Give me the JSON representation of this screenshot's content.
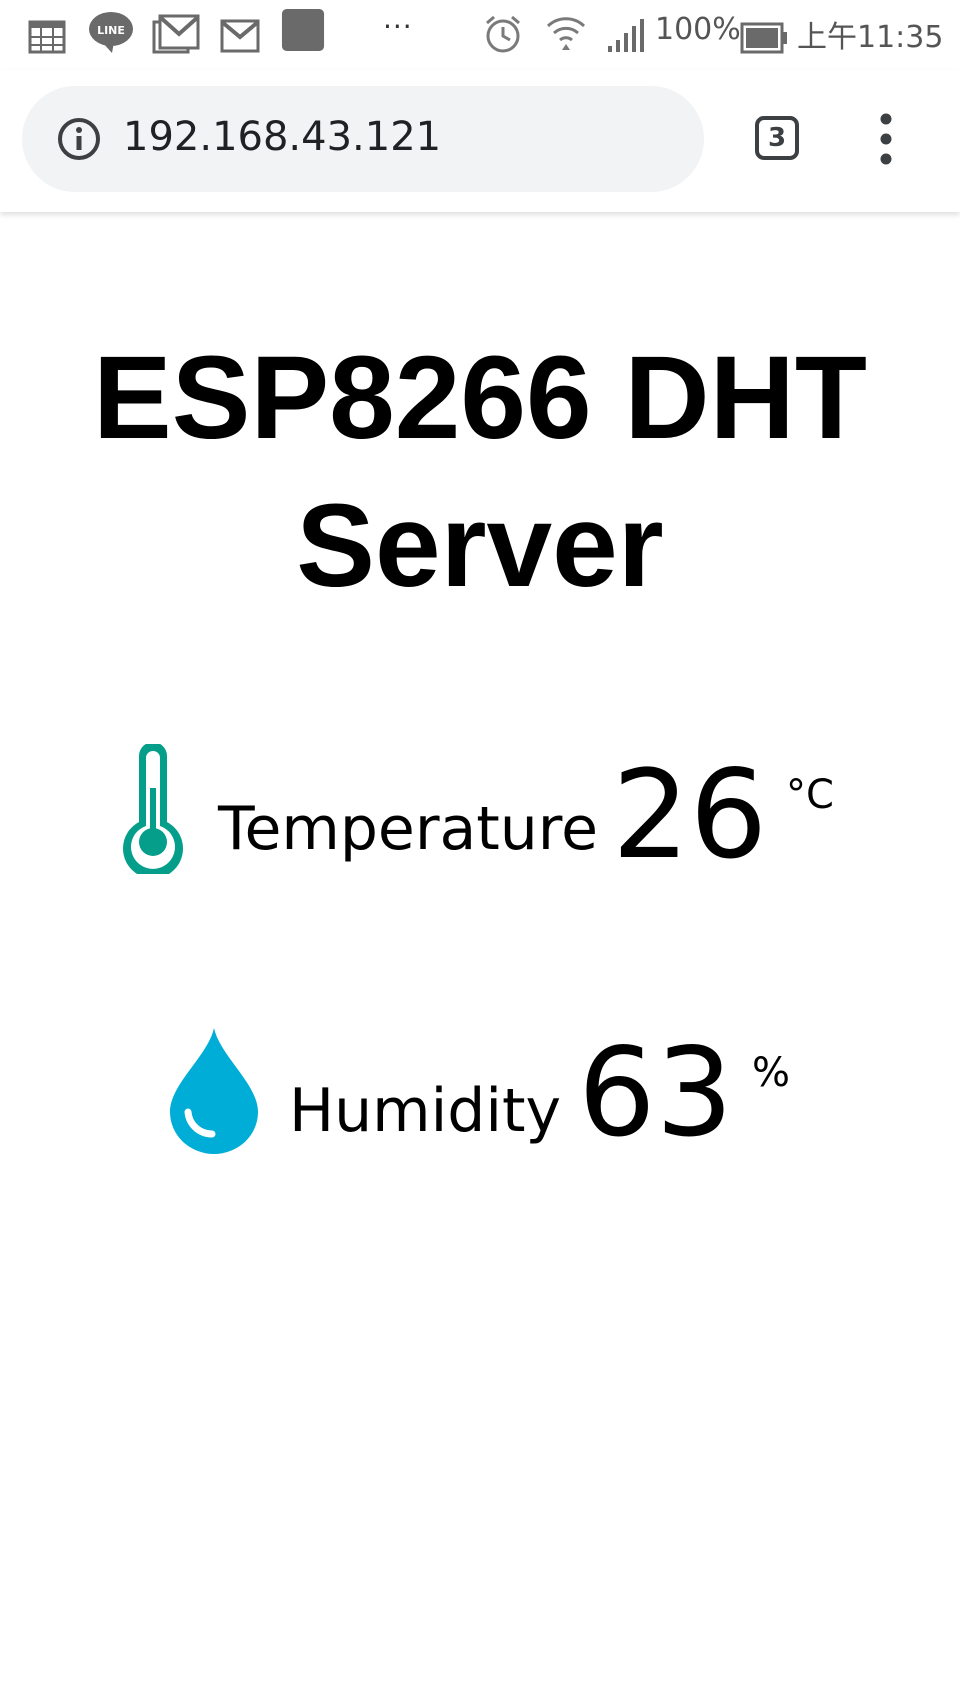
{
  "status_bar": {
    "icons": [
      "calendar-icon",
      "line-app-icon",
      "gmail-stack-icon",
      "gmail-icon",
      "app-square-icon",
      "more-notifications-icon",
      "alarm-icon",
      "wifi-icon",
      "signal-icon",
      "battery-icon"
    ],
    "overflow": "···",
    "battery_percent": "100%",
    "time": "上午11:35"
  },
  "browser": {
    "url": "192.168.43.121",
    "tab_count": "3",
    "info_icon": "info-icon",
    "menu_icon": "more-vert-icon"
  },
  "page": {
    "title": "ESP8266 DHT Server",
    "readings": [
      {
        "label": "Temperature",
        "value": "26",
        "unit": "°C",
        "icon": "thermometer-icon",
        "color": "#059e8a"
      },
      {
        "label": "Humidity",
        "value": "63",
        "unit": "%",
        "icon": "water-drop-icon",
        "color": "#00add6"
      }
    ]
  }
}
